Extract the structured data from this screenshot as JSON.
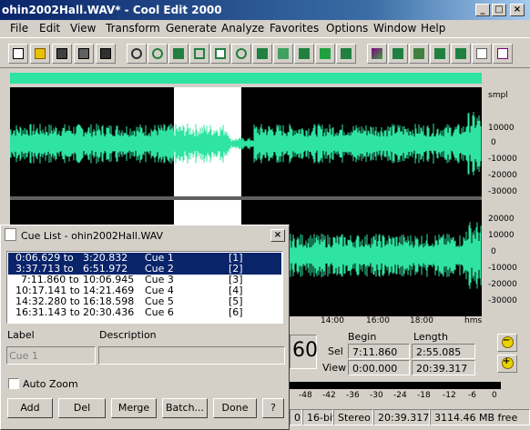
{
  "window": {
    "title": "ohin2002Hall.WAV* - Cool Edit 2000",
    "min": "_",
    "max": "□",
    "close": "×"
  },
  "menu": [
    "File",
    "Edit",
    "View",
    "Transform",
    "Generate",
    "Analyze",
    "Favorites",
    "Options",
    "Window",
    "Help"
  ],
  "toolbar_icons": [
    "new-file-icon",
    "open-folder-icon",
    "save-icon",
    "save-all-icon",
    "close-file-icon",
    "undo-icon",
    "loop-icon",
    "cut-icon",
    "copy-icon",
    "paste-icon",
    "scissors-icon",
    "mix-paste-icon",
    "normalize-icon",
    "effect-icon",
    "spectral-icon",
    "waveform-view-icon",
    "spectral-view-icon",
    "eq-icon",
    "cd-icon",
    "script-icon",
    "frequency-icon",
    "marker-icon",
    "play-list-icon"
  ],
  "scale": {
    "unit": "smpl",
    "upper": [
      "10000",
      "0",
      "-10000",
      "-20000",
      "-30000"
    ],
    "lower": [
      "20000",
      "10000",
      "0",
      "-10000",
      "-20000",
      "-30000"
    ]
  },
  "time_axis": {
    "labels": [
      "14:00",
      "16:00",
      "18:00",
      "hms"
    ]
  },
  "cue_list": {
    "title": "Cue List - ohin2002Hall.WAV",
    "close": "×",
    "rows": [
      {
        "start": "0:06.629 to",
        "end": "3:20.832",
        "name": "Cue 1",
        "idx": "[1]"
      },
      {
        "start": "3:37.713 to",
        "end": "6:51.972",
        "name": "Cue 2",
        "idx": "[2]"
      },
      {
        "start": "7:11.860 to",
        "end": "10:06.945",
        "name": "Cue 3",
        "idx": "[3]"
      },
      {
        "start": "10:17.141 to",
        "end": "14:21.469",
        "name": "Cue 4",
        "idx": "[4]"
      },
      {
        "start": "14:32.280 to",
        "end": "16:18.598",
        "name": "Cue 5",
        "idx": "[5]"
      },
      {
        "start": "16:31.143 to",
        "end": "20:30.436",
        "name": "Cue 6",
        "idx": "[6]"
      }
    ],
    "selected": [
      0,
      1
    ],
    "label_caption": "Label",
    "description_caption": "Description",
    "label_value": "Cue 1",
    "description_value": "",
    "auto_zoom": "Auto Zoom",
    "buttons": [
      "Add",
      "Del",
      "Merge",
      "Batch...",
      "Done",
      "?"
    ]
  },
  "time_display": "60",
  "selection": {
    "begin_caption": "Begin",
    "length_caption": "Length",
    "sel": "Sel",
    "view": "View",
    "sel_begin": "7:11.860",
    "sel_length": "2:55.085",
    "view_begin": "0:00.000",
    "view_length": "20:39.317"
  },
  "level_meter": [
    "-48",
    "-42",
    "-36",
    "-30",
    "-24",
    "-18",
    "-12",
    "-6",
    "0"
  ],
  "status": {
    "rate_tail": "0",
    "bits": "16-bit",
    "channels": "Stereo",
    "duration": "20:39.317",
    "free": "3114.46 MB free"
  },
  "colors": {
    "waveform": "#2fe3a3",
    "selection_bg": "#ffffff",
    "title_bar": "#0a246a"
  }
}
